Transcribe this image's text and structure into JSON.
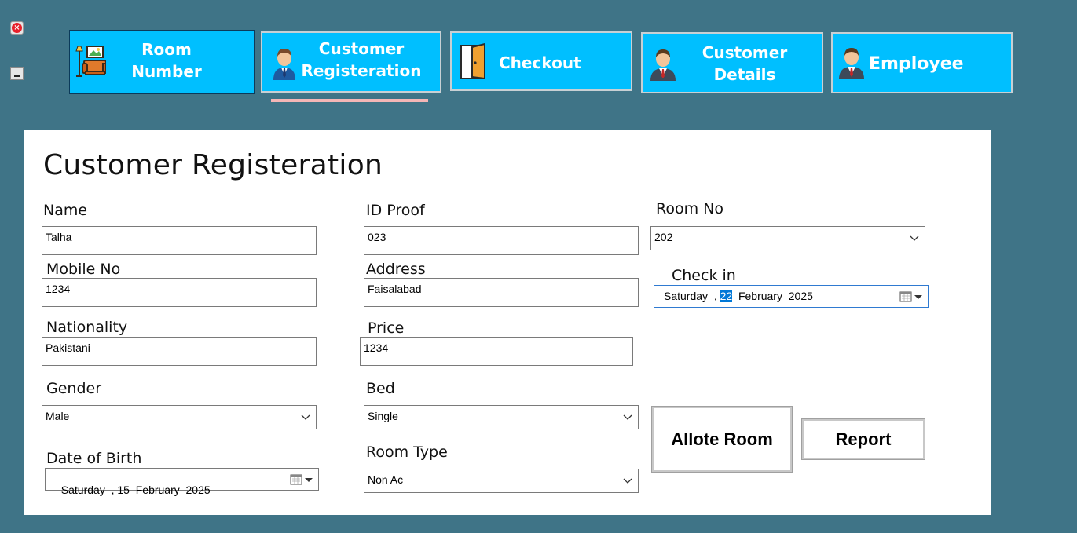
{
  "window": {
    "close_icon": "close-icon",
    "minimize_icon": "minimize-icon"
  },
  "nav": {
    "room_number": {
      "line1": "Room",
      "line2": "Number",
      "icon": "room-furniture-icon"
    },
    "customer_registration": {
      "line1": "Customer",
      "line2": "Registeration",
      "icon": "customer-icon"
    },
    "checkout": {
      "label": "Checkout",
      "icon": "door-icon"
    },
    "customer_details": {
      "line1": "Customer",
      "line2": "Details",
      "icon": "customer-icon"
    },
    "employee": {
      "label": "Employee",
      "icon": "employee-icon"
    }
  },
  "form": {
    "title": "Customer Registeration",
    "name": {
      "label": "Name",
      "value": "Talha"
    },
    "mobile": {
      "label": "Mobile No",
      "value": "1234"
    },
    "nationality": {
      "label": "Nationality",
      "value": "Pakistani"
    },
    "gender": {
      "label": "Gender",
      "value": "Male"
    },
    "dob": {
      "label": "Date of Birth",
      "value": "Saturday  , 15  February  2025"
    },
    "id_proof": {
      "label": "ID Proof",
      "value": "023"
    },
    "address": {
      "label": "Address",
      "value": "Faisalabad"
    },
    "price": {
      "label": "Price",
      "value": "1234"
    },
    "bed": {
      "label": "Bed",
      "value": "Single"
    },
    "room_type": {
      "label": "Room Type",
      "value": "Non Ac"
    },
    "room_no": {
      "label": "Room No",
      "value": "202"
    },
    "check_in": {
      "label": "Check in",
      "prefix": "Saturday  , ",
      "day": "22",
      "suffix": "  February  2025"
    },
    "allot_button": "Allote Room",
    "report_button": "Report"
  },
  "colors": {
    "background": "#3f7487",
    "nav_button": "#00bfff",
    "panel": "#ffffff",
    "selected_underline": "#f4b6b6"
  }
}
